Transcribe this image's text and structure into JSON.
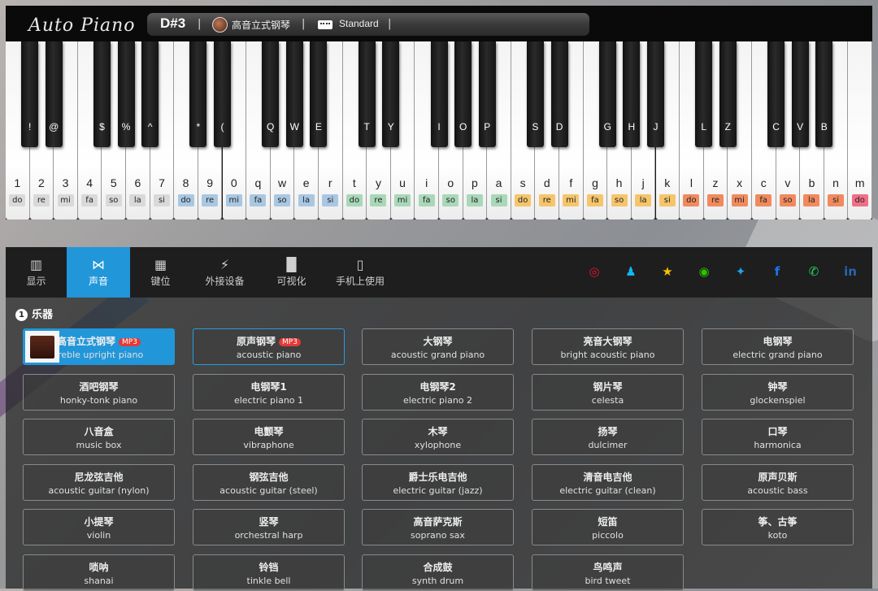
{
  "header": {
    "logo": "Auto Piano",
    "note": "D#3",
    "separator": "|",
    "instrument": "高音立式钢琴",
    "mode": "Standard"
  },
  "keyboard": {
    "white_keys": [
      {
        "label": "1",
        "solfege": "do",
        "color": "#d9d9d9"
      },
      {
        "label": "2",
        "solfege": "re",
        "color": "#d9d9d9"
      },
      {
        "label": "3",
        "solfege": "mi",
        "color": "#d9d9d9"
      },
      {
        "label": "4",
        "solfege": "fa",
        "color": "#d9d9d9"
      },
      {
        "label": "5",
        "solfege": "so",
        "color": "#d9d9d9"
      },
      {
        "label": "6",
        "solfege": "la",
        "color": "#d9d9d9"
      },
      {
        "label": "7",
        "solfege": "si",
        "color": "#d9d9d9"
      },
      {
        "label": "8",
        "solfege": "do",
        "color": "#a9c7e3"
      },
      {
        "label": "9",
        "solfege": "re",
        "color": "#a9c7e3"
      },
      {
        "label": "0",
        "solfege": "mi",
        "color": "#a9c7e3"
      },
      {
        "label": "q",
        "solfege": "fa",
        "color": "#a9c7e3"
      },
      {
        "label": "w",
        "solfege": "so",
        "color": "#a9c7e3"
      },
      {
        "label": "e",
        "solfege": "la",
        "color": "#a9c7e3"
      },
      {
        "label": "r",
        "solfege": "si",
        "color": "#a9c7e3"
      },
      {
        "label": "t",
        "solfege": "do",
        "color": "#a9d8b8"
      },
      {
        "label": "y",
        "solfege": "re",
        "color": "#a9d8b8"
      },
      {
        "label": "u",
        "solfege": "mi",
        "color": "#a9d8b8"
      },
      {
        "label": "i",
        "solfege": "fa",
        "color": "#a9d8b8"
      },
      {
        "label": "o",
        "solfege": "so",
        "color": "#a9d8b8"
      },
      {
        "label": "p",
        "solfege": "la",
        "color": "#a9d8b8"
      },
      {
        "label": "a",
        "solfege": "si",
        "color": "#a9d8b8"
      },
      {
        "label": "s",
        "solfege": "do",
        "color": "#f6c56b"
      },
      {
        "label": "d",
        "solfege": "re",
        "color": "#f6c56b"
      },
      {
        "label": "f",
        "solfege": "mi",
        "color": "#f6c56b"
      },
      {
        "label": "g",
        "solfege": "fa",
        "color": "#f6c56b"
      },
      {
        "label": "h",
        "solfege": "so",
        "color": "#f6c56b"
      },
      {
        "label": "j",
        "solfege": "la",
        "color": "#f6c56b"
      },
      {
        "label": "k",
        "solfege": "si",
        "color": "#f6c56b"
      },
      {
        "label": "l",
        "solfege": "do",
        "color": "#f08a5e"
      },
      {
        "label": "z",
        "solfege": "re",
        "color": "#f08a5e"
      },
      {
        "label": "x",
        "solfege": "mi",
        "color": "#f08a5e"
      },
      {
        "label": "c",
        "solfege": "fa",
        "color": "#f08a5e"
      },
      {
        "label": "v",
        "solfege": "so",
        "color": "#f08a5e"
      },
      {
        "label": "b",
        "solfege": "la",
        "color": "#f08a5e"
      },
      {
        "label": "n",
        "solfege": "si",
        "color": "#f08a5e"
      },
      {
        "label": "m",
        "solfege": "do",
        "color": "#ef6f86"
      }
    ],
    "black_keys": [
      {
        "label": "!",
        "after": 0
      },
      {
        "label": "@",
        "after": 1
      },
      {
        "label": "$",
        "after": 3
      },
      {
        "label": "%",
        "after": 4
      },
      {
        "label": "^",
        "after": 5
      },
      {
        "label": "*",
        "after": 7
      },
      {
        "label": "(",
        "after": 8
      },
      {
        "label": "Q",
        "after": 10
      },
      {
        "label": "W",
        "after": 11
      },
      {
        "label": "E",
        "after": 12
      },
      {
        "label": "T",
        "after": 14
      },
      {
        "label": "Y",
        "after": 15
      },
      {
        "label": "I",
        "after": 17
      },
      {
        "label": "O",
        "after": 18
      },
      {
        "label": "P",
        "after": 19
      },
      {
        "label": "S",
        "after": 21
      },
      {
        "label": "D",
        "after": 22
      },
      {
        "label": "G",
        "after": 24
      },
      {
        "label": "H",
        "after": 25
      },
      {
        "label": "J",
        "after": 26
      },
      {
        "label": "L",
        "after": 28
      },
      {
        "label": "Z",
        "after": 29
      },
      {
        "label": "C",
        "after": 31
      },
      {
        "label": "V",
        "after": 32
      },
      {
        "label": "B",
        "after": 33
      }
    ]
  },
  "tabs": [
    {
      "label": "显示",
      "icon": "piano-keys-icon",
      "glyph": "▥"
    },
    {
      "label": "声音",
      "icon": "sound-wave-icon",
      "glyph": "⋈",
      "active": true
    },
    {
      "label": "键位",
      "icon": "keyboard-icon",
      "glyph": "▦"
    },
    {
      "label": "外接设备",
      "icon": "plug-icon",
      "glyph": "⚡"
    },
    {
      "label": "可视化",
      "icon": "bar-chart-icon",
      "glyph": "▐▌"
    },
    {
      "label": "手机上使用",
      "icon": "phone-icon",
      "glyph": "▯"
    }
  ],
  "social": [
    {
      "name": "weibo-icon",
      "glyph": "◎",
      "color": "#e6162d"
    },
    {
      "name": "qq-icon",
      "glyph": "♟",
      "color": "#12b7f5"
    },
    {
      "name": "qzone-icon",
      "glyph": "★",
      "color": "#f5c400"
    },
    {
      "name": "wechat-icon",
      "glyph": "◉",
      "color": "#2dc100"
    },
    {
      "name": "twitter-icon",
      "glyph": "✦",
      "color": "#1da1f2"
    },
    {
      "name": "facebook-icon",
      "glyph": "f",
      "color": "#1877f2"
    },
    {
      "name": "whatsapp-icon",
      "glyph": "✆",
      "color": "#25d366"
    },
    {
      "name": "linkedin-icon",
      "glyph": "in",
      "color": "#2867b2"
    }
  ],
  "section": {
    "number": "1",
    "title": "乐器"
  },
  "instruments": [
    {
      "cn": "高音立式钢琴",
      "en": "treble upright piano",
      "mp3": "MP3",
      "selected": true
    },
    {
      "cn": "原声钢琴",
      "en": "acoustic piano",
      "mp3": "MP3",
      "outlined": true
    },
    {
      "cn": "大钢琴",
      "en": "acoustic grand piano"
    },
    {
      "cn": "亮音大钢琴",
      "en": "bright acoustic piano"
    },
    {
      "cn": "电钢琴",
      "en": "electric grand piano"
    },
    {
      "cn": "酒吧钢琴",
      "en": "honky-tonk piano"
    },
    {
      "cn": "电钢琴1",
      "en": "electric piano 1"
    },
    {
      "cn": "电钢琴2",
      "en": "electric piano 2"
    },
    {
      "cn": "钢片琴",
      "en": "celesta"
    },
    {
      "cn": "钟琴",
      "en": "glockenspiel"
    },
    {
      "cn": "八音盒",
      "en": "music box"
    },
    {
      "cn": "电颤琴",
      "en": "vibraphone"
    },
    {
      "cn": "木琴",
      "en": "xylophone"
    },
    {
      "cn": "扬琴",
      "en": "dulcimer"
    },
    {
      "cn": "口琴",
      "en": "harmonica"
    },
    {
      "cn": "尼龙弦吉他",
      "en": "acoustic guitar (nylon)"
    },
    {
      "cn": "钢弦吉他",
      "en": "acoustic guitar (steel)"
    },
    {
      "cn": "爵士乐电吉他",
      "en": "electric guitar (jazz)"
    },
    {
      "cn": "清音电吉他",
      "en": "electric guitar (clean)"
    },
    {
      "cn": "原声贝斯",
      "en": "acoustic bass"
    },
    {
      "cn": "小提琴",
      "en": "violin"
    },
    {
      "cn": "竖琴",
      "en": "orchestral harp"
    },
    {
      "cn": "高音萨克斯",
      "en": "soprano sax"
    },
    {
      "cn": "短笛",
      "en": "piccolo"
    },
    {
      "cn": "筝、古筝",
      "en": "koto"
    },
    {
      "cn": "唢呐",
      "en": "shanai"
    },
    {
      "cn": "铃铛",
      "en": "tinkle bell"
    },
    {
      "cn": "合成鼓",
      "en": "synth drum"
    },
    {
      "cn": "鸟鸣声",
      "en": "bird tweet"
    }
  ]
}
